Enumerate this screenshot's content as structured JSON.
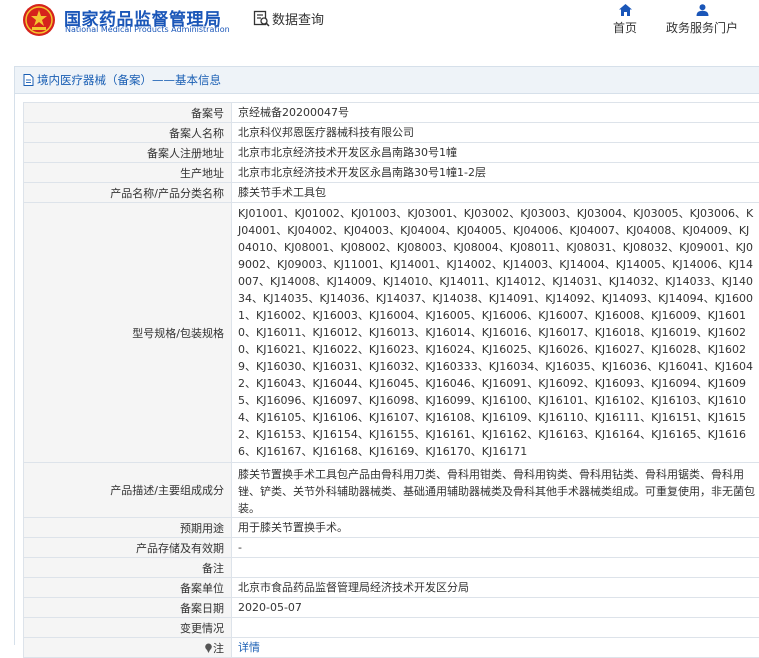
{
  "header": {
    "brand_cn": "国家药品监督管理局",
    "brand_en": "National Medical Products Administration",
    "data_query": "数据查询",
    "nav": [
      {
        "label": "首页",
        "icon": "home-icon"
      },
      {
        "label": "政务服务门户",
        "icon": "user-icon"
      }
    ],
    "brand_color": "#1a56b8",
    "emblem_color": "#d6231c"
  },
  "breadcrumb": {
    "text": "境内医疗器械（备案）——基本信息"
  },
  "record": {
    "labels": {
      "filing_no": "备案号",
      "registrant": "备案人名称",
      "reg_address": "备案人注册地址",
      "prod_address": "生产地址",
      "product_name": "产品名称/产品分类名称",
      "model": "型号规格/包装规格",
      "description": "产品描述/主要组成成分",
      "intended_use": "预期用途",
      "storage": "产品存储及有效期",
      "remark": "备注",
      "filing_unit": "备案单位",
      "filing_date": "备案日期",
      "change": "变更情况",
      "note": "注"
    },
    "values": {
      "filing_no": "京经械备20200047号",
      "registrant": "北京科仪邦恩医疗器械科技有限公司",
      "reg_address": "北京市北京经济技术开发区永昌南路30号1幢",
      "prod_address": "北京市北京经济技术开发区永昌南路30号1幢1-2层",
      "product_name": "膝关节手术工具包",
      "model": "KJ01001、KJ01002、KJ01003、KJ03001、KJ03002、KJ03003、KJ03004、KJ03005、KJ03006、KJ04001、KJ04002、KJ04003、KJ04004、KJ04005、KJ04006、KJ04007、KJ04008、KJ04009、KJ04010、KJ08001、KJ08002、KJ08003、KJ08004、KJ08011、KJ08031、KJ08032、KJ09001、KJ09002、KJ09003、KJ11001、KJ14001、KJ14002、KJ14003、KJ14004、KJ14005、KJ14006、KJ14007、KJ14008、KJ14009、KJ14010、KJ14011、KJ14012、KJ14031、KJ14032、KJ14033、KJ14034、KJ14035、KJ14036、KJ14037、KJ14038、KJ14091、KJ14092、KJ14093、KJ14094、KJ16001、KJ16002、KJ16003、KJ16004、KJ16005、KJ16006、KJ16007、KJ16008、KJ16009、KJ16010、KJ16011、KJ16012、KJ16013、KJ16014、KJ16016、KJ16017、KJ16018、KJ16019、KJ16020、KJ16021、KJ16022、KJ16023、KJ16024、KJ16025、KJ16026、KJ16027、KJ16028、KJ16029、KJ16030、KJ16031、KJ16032、KJ160333、KJ16034、KJ16035、KJ16036、KJ16041、KJ16042、KJ16043、KJ16044、KJ16045、KJ16046、KJ16091、KJ16092、KJ16093、KJ16094、KJ16095、KJ16096、KJ16097、KJ16098、KJ16099、KJ16100、KJ16101、KJ16102、KJ16103、KJ16104、KJ16105、KJ16106、KJ16107、KJ16108、KJ16109、KJ16110、KJ16111、KJ16151、KJ16152、KJ16153、KJ16154、KJ16155、KJ16161、KJ16162、KJ16163、KJ16164、KJ16165、KJ16166、KJ16167、KJ16168、KJ16169、KJ16170、KJ16171",
      "description": "膝关节置换手术工具包产品由骨科用刀类、骨科用钳类、骨科用钩类、骨科用钻类、骨科用锯类、骨科用锉、铲类、关节外科辅助器械类、基础通用辅助器械类及骨科其他手术器械类组成。可重复使用，非无菌包装。",
      "intended_use": "用于膝关节置换手术。",
      "storage": "-",
      "remark": "",
      "filing_unit": "北京市食品药品监督管理局经济技术开发区分局",
      "filing_date": "2020-05-07",
      "change": "",
      "note_link": "详情"
    }
  }
}
